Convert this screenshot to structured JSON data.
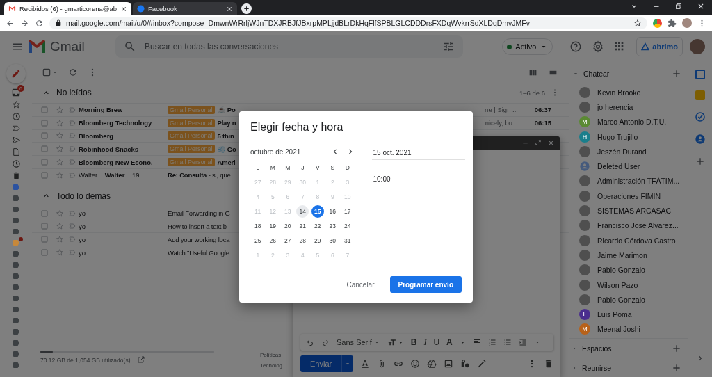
{
  "browser": {
    "tabs": [
      {
        "title": "Recibidos (6) - gmarticorena@ab",
        "kind": "gmail",
        "selected": true
      },
      {
        "title": "Facebook",
        "kind": "facebook",
        "selected": false
      }
    ],
    "url": "mail.google.com/mail/u/0/#inbox?compose=DmwnWrRrljWJnTDXJRBJfJBxrpMPLjjdBLrDkHqFlfSPBLGLCDDDrsFXDqWvkrrSdXLDqDmvJMFv"
  },
  "header": {
    "product": "Gmail",
    "search_placeholder": "Buscar en todas las conversaciones",
    "status": "Activo",
    "org_logo": "abrimo"
  },
  "rail": {
    "inbox_badge": "6",
    "labels": [
      {
        "color": "#2b52a0",
        "notified": false
      },
      {
        "color": "#3c4043",
        "notified": false
      },
      {
        "color": "#3c4043",
        "notified": false
      },
      {
        "color": "#3c4043",
        "notified": false
      },
      {
        "color": "#3c4043",
        "notified": false
      },
      {
        "color": "#c7883a",
        "notified": true
      },
      {
        "color": "#3c4043",
        "notified": false
      },
      {
        "color": "#3c4043",
        "notified": false
      },
      {
        "color": "#3c4043",
        "notified": false
      },
      {
        "color": "#3c4043",
        "notified": false
      },
      {
        "color": "#3c4043",
        "notified": false
      },
      {
        "color": "#3c4043",
        "notified": false
      },
      {
        "color": "#3c4043",
        "notified": false
      },
      {
        "color": "#3c4043",
        "notified": false
      },
      {
        "color": "#3c4043",
        "notified": false
      },
      {
        "color": "#3c4043",
        "notified": false
      },
      {
        "color": "#3c4043",
        "notified": false
      }
    ]
  },
  "mail": {
    "select_all_checked": false,
    "range": "1–6 de 6",
    "sections": [
      {
        "title": "No leídos",
        "rows": [
          {
            "sender": "Morning Brew",
            "checked": false,
            "unread": true,
            "label": "Gmail Personal",
            "subject": "☕ Po",
            "tail": "ne | Sign ...",
            "time": "06:37"
          },
          {
            "sender": "Bloomberg Technology",
            "checked": false,
            "unread": true,
            "label": "Gmail Personal",
            "subject": "Play n",
            "tail": "nicely, bu...",
            "time": "06:15"
          },
          {
            "sender": "Bloomberg",
            "checked": false,
            "unread": true,
            "label": "Gmail Personal",
            "subject": "5 thin"
          },
          {
            "sender": "Robinhood Snacks",
            "checked": false,
            "unread": true,
            "label": "Gmail Personal",
            "subject": "💨 Go"
          },
          {
            "sender": "Bloomberg New Econo.",
            "checked": false,
            "unread": true,
            "label": "Gmail Personal",
            "subject": "Ameri"
          },
          {
            "sender": "Walter .. **Walter** .. 19",
            "checked": false,
            "unread": false,
            "subject": "**Re: Consulta** - si, que"
          }
        ]
      },
      {
        "title": "Todo lo demás",
        "rows": [
          {
            "sender": "yo",
            "checked": false,
            "unread": false,
            "subject": "Email Forwarding in G"
          },
          {
            "sender": "yo",
            "checked": false,
            "unread": false,
            "subject": "How to insert a text b"
          },
          {
            "sender": "yo",
            "checked": false,
            "unread": false,
            "subject": "Add your working loca"
          },
          {
            "sender": "yo",
            "checked": false,
            "unread": false,
            "subject": "Watch \"Useful Google"
          }
        ]
      }
    ]
  },
  "footer": {
    "storage": "70.12 GB de 1,054 GB utilizado(s)",
    "level": 0.07,
    "links": [
      "Políticas",
      "Tecnolog"
    ]
  },
  "chat": {
    "title": "Chatear",
    "contacts": [
      {
        "name": "Kevin Brooke",
        "kind": "photo"
      },
      {
        "name": "jo herencia",
        "kind": "photo"
      },
      {
        "name": "Marco Antonio D.T.U.",
        "kind": "letter",
        "initial": "M",
        "color": "#5b8a33"
      },
      {
        "name": "Hugo Trujillo",
        "kind": "letter",
        "initial": "H",
        "color": "#1a7f8c"
      },
      {
        "name": "Jeszén Durand",
        "kind": "photo"
      },
      {
        "name": "Deleted User",
        "kind": "silhouette"
      },
      {
        "name": "Administración TFÁTIM...",
        "kind": "photo"
      },
      {
        "name": "Operaciones FIMIN",
        "kind": "photo"
      },
      {
        "name": "SISTEMAS ARCASAC",
        "kind": "photo"
      },
      {
        "name": "Francisco Jose Alvarez...",
        "kind": "photo"
      },
      {
        "name": "Ricardo Córdova Castro",
        "kind": "photo"
      },
      {
        "name": "Jaime Marimon",
        "kind": "photo"
      },
      {
        "name": "Pablo Gonzalo",
        "kind": "photo"
      },
      {
        "name": "Wilson Pazo",
        "kind": "photo"
      },
      {
        "name": "Pablo Gonzalo",
        "kind": "photo"
      },
      {
        "name": "Luis Poma",
        "kind": "letter",
        "initial": "L",
        "color": "#4a2e8e"
      },
      {
        "name": "Meenal Joshi",
        "kind": "letter",
        "initial": "M",
        "color": "#b8621a"
      }
    ],
    "sections": [
      "Espacios",
      "Reunirse"
    ]
  },
  "compose": {
    "font": "Sans Serif",
    "format": [
      "B",
      "I",
      "U",
      "A"
    ],
    "send": "Enviar"
  },
  "dialog": {
    "title": "Elegir fecha y hora",
    "month": "octubre de 2021",
    "weekdays": [
      "L",
      "M",
      "M",
      "J",
      "V",
      "S",
      "D"
    ],
    "weeks": [
      [
        {
          "d": "27",
          "muted": true,
          "today": false,
          "selected": false
        },
        {
          "d": "28",
          "muted": true,
          "today": false,
          "selected": false
        },
        {
          "d": "29",
          "muted": true,
          "today": false,
          "selected": false
        },
        {
          "d": "30",
          "muted": true,
          "today": false,
          "selected": false
        },
        {
          "d": "1",
          "muted": true,
          "today": false,
          "selected": false
        },
        {
          "d": "2",
          "muted": true,
          "today": false,
          "selected": false
        },
        {
          "d": "3",
          "muted": true,
          "today": false,
          "selected": false
        }
      ],
      [
        {
          "d": "4",
          "muted": true,
          "today": false,
          "selected": false
        },
        {
          "d": "5",
          "muted": true,
          "today": false,
          "selected": false
        },
        {
          "d": "6",
          "muted": true,
          "today": false,
          "selected": false
        },
        {
          "d": "7",
          "muted": true,
          "today": false,
          "selected": false
        },
        {
          "d": "8",
          "muted": true,
          "today": false,
          "selected": false
        },
        {
          "d": "9",
          "muted": true,
          "today": false,
          "selected": false
        },
        {
          "d": "10",
          "muted": true,
          "today": false,
          "selected": false
        }
      ],
      [
        {
          "d": "11",
          "muted": true,
          "today": false,
          "selected": false
        },
        {
          "d": "12",
          "muted": true,
          "today": false,
          "selected": false
        },
        {
          "d": "13",
          "muted": true,
          "today": false,
          "selected": false
        },
        {
          "d": "14",
          "muted": false,
          "today": true,
          "selected": false
        },
        {
          "d": "15",
          "muted": false,
          "today": false,
          "selected": true
        },
        {
          "d": "16",
          "muted": false,
          "today": false,
          "selected": false
        },
        {
          "d": "17",
          "muted": false,
          "today": false,
          "selected": false
        }
      ],
      [
        {
          "d": "18",
          "muted": false,
          "today": false,
          "selected": false
        },
        {
          "d": "19",
          "muted": false,
          "today": false,
          "selected": false
        },
        {
          "d": "20",
          "muted": false,
          "today": false,
          "selected": false
        },
        {
          "d": "21",
          "muted": false,
          "today": false,
          "selected": false
        },
        {
          "d": "22",
          "muted": false,
          "today": false,
          "selected": false
        },
        {
          "d": "23",
          "muted": false,
          "today": false,
          "selected": false
        },
        {
          "d": "24",
          "muted": false,
          "today": false,
          "selected": false
        }
      ],
      [
        {
          "d": "25",
          "muted": false,
          "today": false,
          "selected": false
        },
        {
          "d": "26",
          "muted": false,
          "today": false,
          "selected": false
        },
        {
          "d": "27",
          "muted": false,
          "today": false,
          "selected": false
        },
        {
          "d": "28",
          "muted": false,
          "today": false,
          "selected": false
        },
        {
          "d": "29",
          "muted": false,
          "today": false,
          "selected": false
        },
        {
          "d": "30",
          "muted": false,
          "today": false,
          "selected": false
        },
        {
          "d": "31",
          "muted": false,
          "today": false,
          "selected": false
        }
      ],
      [
        {
          "d": "1",
          "muted": true,
          "today": false,
          "selected": false
        },
        {
          "d": "2",
          "muted": true,
          "today": false,
          "selected": false
        },
        {
          "d": "3",
          "muted": true,
          "today": false,
          "selected": false
        },
        {
          "d": "4",
          "muted": true,
          "today": false,
          "selected": false
        },
        {
          "d": "5",
          "muted": true,
          "today": false,
          "selected": false
        },
        {
          "d": "6",
          "muted": true,
          "today": false,
          "selected": false
        },
        {
          "d": "7",
          "muted": true,
          "today": false,
          "selected": false
        }
      ]
    ],
    "date": "15 oct. 2021",
    "time": "10:00",
    "cancel": "Cancelar",
    "confirm": "Programar envío"
  }
}
